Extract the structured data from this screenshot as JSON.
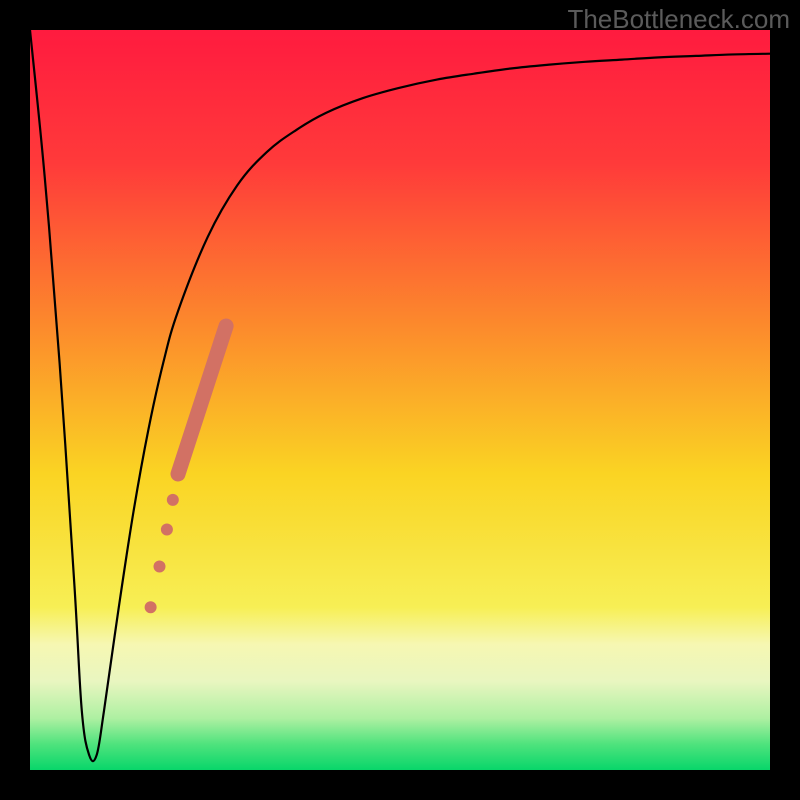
{
  "watermark": "TheBottleneck.com",
  "chart_data": {
    "type": "line",
    "title": "",
    "xlabel": "",
    "ylabel": "",
    "xlim": [
      0,
      100
    ],
    "ylim": [
      0,
      100
    ],
    "background_gradient": {
      "stops": [
        {
          "offset": 0.0,
          "color": "#ff1b3f"
        },
        {
          "offset": 0.18,
          "color": "#ff3a3a"
        },
        {
          "offset": 0.4,
          "color": "#fc8a2c"
        },
        {
          "offset": 0.6,
          "color": "#fad423"
        },
        {
          "offset": 0.78,
          "color": "#f7ef55"
        },
        {
          "offset": 0.83,
          "color": "#f6f7b2"
        },
        {
          "offset": 0.88,
          "color": "#e9f6c0"
        },
        {
          "offset": 0.93,
          "color": "#aef0a2"
        },
        {
          "offset": 0.965,
          "color": "#4fe37d"
        },
        {
          "offset": 1.0,
          "color": "#08d66a"
        }
      ]
    },
    "series": [
      {
        "name": "bottleneck-curve",
        "color": "#000000",
        "stroke_width": 2.2,
        "x": [
          0,
          2,
          4,
          6,
          7,
          8,
          9,
          10,
          12,
          14,
          16,
          18,
          20,
          24,
          28,
          32,
          36,
          40,
          45,
          50,
          55,
          60,
          65,
          70,
          75,
          80,
          85,
          90,
          95,
          100
        ],
        "values": [
          100,
          80,
          55,
          25,
          8,
          2,
          2,
          8,
          22,
          35,
          46,
          55,
          62,
          72,
          79,
          83.5,
          86.5,
          88.8,
          90.8,
          92.2,
          93.3,
          94.1,
          94.8,
          95.3,
          95.7,
          96.0,
          96.3,
          96.5,
          96.7,
          96.8
        ]
      }
    ],
    "markers": {
      "name": "bottleneck-markers",
      "color": "#d27164",
      "items": [
        {
          "x": 16.3,
          "y": 22.0,
          "r": 6
        },
        {
          "x": 17.5,
          "y": 27.5,
          "r": 6
        },
        {
          "x": 18.5,
          "y": 32.5,
          "r": 6
        },
        {
          "x": 19.3,
          "y": 36.5,
          "r": 6
        }
      ],
      "thick_segment": {
        "x": [
          20.0,
          26.5
        ],
        "y": [
          40.0,
          60.0
        ],
        "width": 15
      }
    }
  }
}
